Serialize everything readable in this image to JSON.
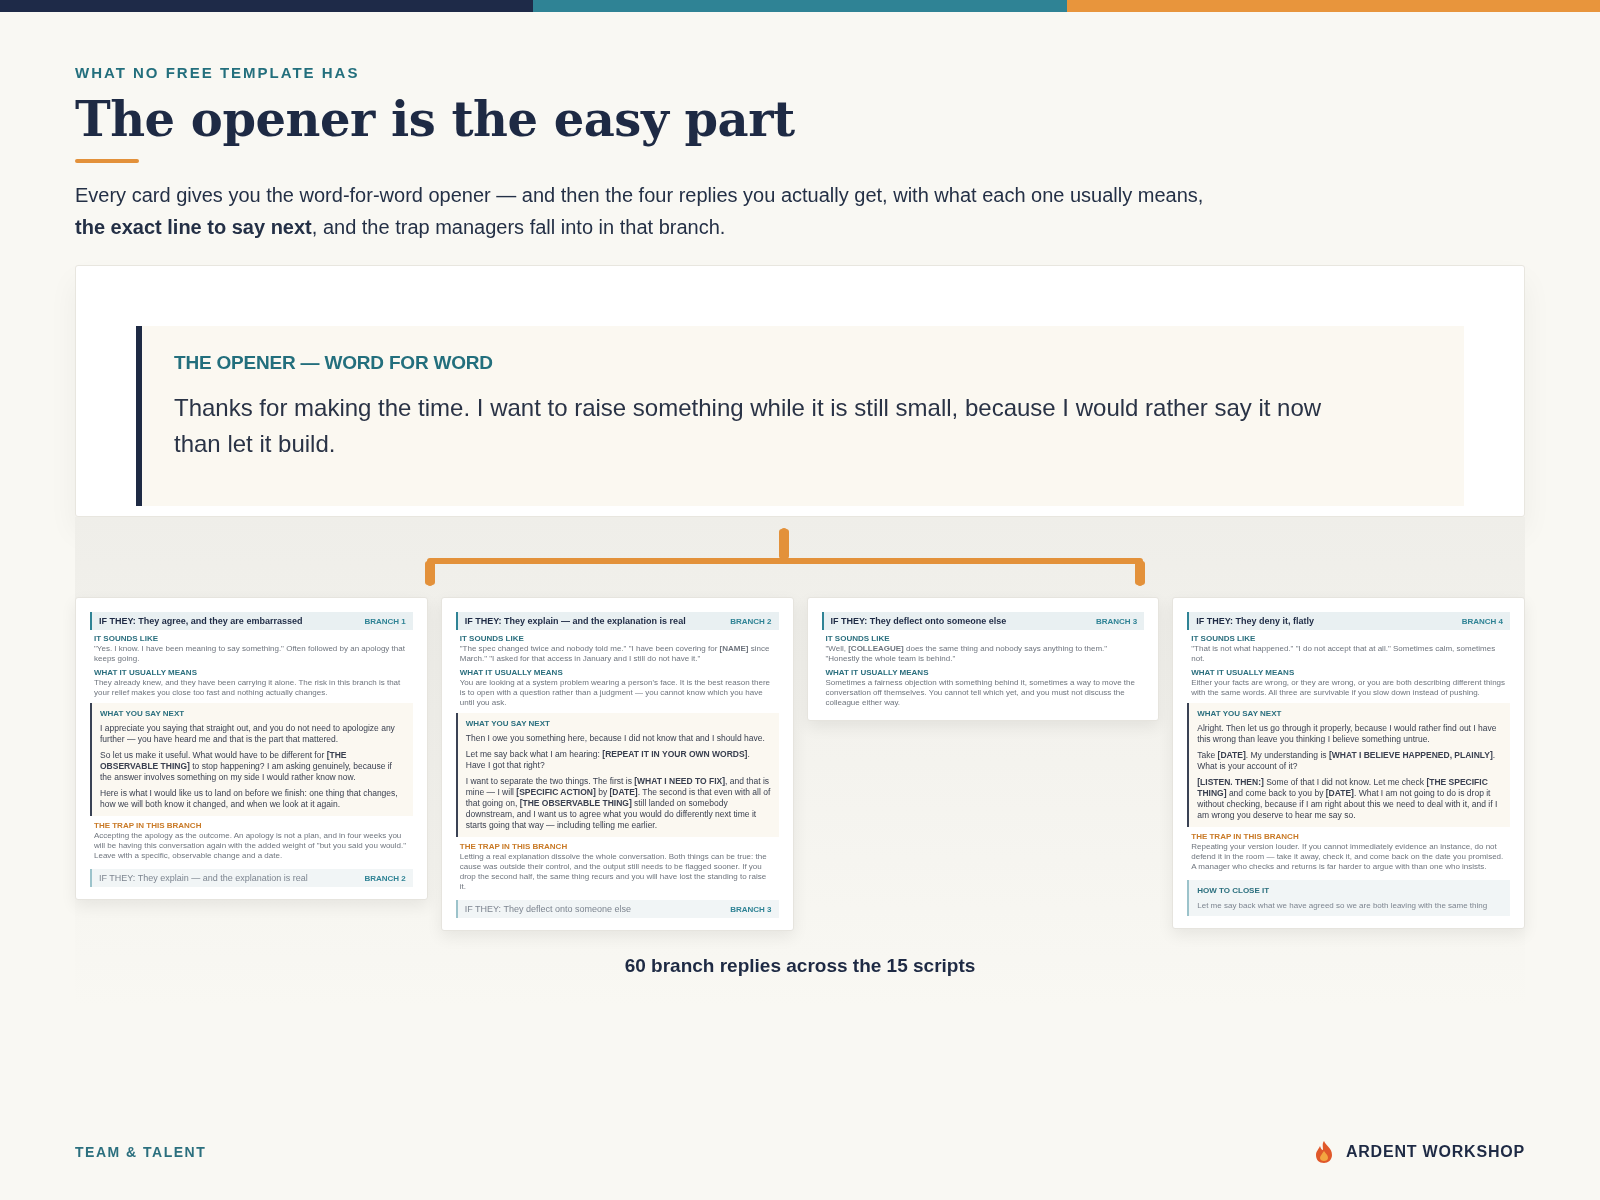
{
  "eyebrow": "WHAT NO FREE TEMPLATE HAS",
  "title": "The opener is the easy part",
  "intro": "Every card gives you the word-for-word opener — and then the four replies you actually get, with what each one usually means, **the exact line to say next**, and the trap managers fall into in that branch.",
  "opener": {
    "label": "THE OPENER — WORD FOR WORD",
    "text": "Thanks for making the time. I want to raise something while it is still small, because I would rather say it now than let it build."
  },
  "cards": [
    {
      "heading": "IF THEY: They agree, and they are embarrassed",
      "branch": "BRANCH 1",
      "sounds_like_label": "IT SOUNDS LIKE",
      "sounds_like": "\"Yes. I know. I have been meaning to say something.\" Often followed by an apology that keeps going.",
      "means_label": "WHAT IT USUALLY MEANS",
      "means": "They already knew, and they have been carrying it alone. The risk in this branch is that your relief makes you close too fast and nothing actually changes.",
      "say_next_label": "WHAT YOU SAY NEXT",
      "say_next": [
        "I appreciate you saying that straight out, and you do not need to apologize any further — you have heard me and that is the part that mattered.",
        "So let us make it useful. What would have to be different for **[THE OBSERVABLE THING]** to stop happening? I am asking genuinely, because if the answer involves something on my side I would rather know now.",
        "Here is what I would like us to land on before we finish: one thing that changes, how we will both know it changed, and when we look at it again."
      ],
      "trap_label": "THE TRAP IN THIS BRANCH",
      "trap": "Accepting the apology as the outcome. An apology is not a plan, and in four weeks you will be having this conversation again with the added weight of \"but you said you would.\" Leave with a specific, observable change and a date.",
      "next": {
        "kind": "branch",
        "heading": "IF THEY: They explain — and the explanation is real",
        "branch": "BRANCH 2"
      }
    },
    {
      "heading": "IF THEY: They explain — and the explanation is real",
      "branch": "BRANCH 2",
      "sounds_like_label": "IT SOUNDS LIKE",
      "sounds_like": "\"The spec changed twice and nobody told me.\" \"I have been covering for **[NAME]** since March.\" \"I asked for that access in January and I still do not have it.\"",
      "means_label": "WHAT IT USUALLY MEANS",
      "means": "You are looking at a system problem wearing a person's face. It is the best reason there is to open with a question rather than a judgment — you cannot know which you have until you ask.",
      "say_next_label": "WHAT YOU SAY NEXT",
      "say_next": [
        "Then I owe you something here, because I did not know that and I should have.",
        "Let me say back what I am hearing: **[REPEAT IT IN YOUR OWN WORDS]**. Have I got that right?",
        "I want to separate the two things. The first is **[WHAT I NEED TO FIX]**, and that is mine — I will **[SPECIFIC ACTION]** by **[DATE]**. The second is that even with all of that going on, **[THE OBSERVABLE THING]** still landed on somebody downstream, and I want us to agree what you would do differently next time it starts going that way — including telling me earlier."
      ],
      "trap_label": "THE TRAP IN THIS BRANCH",
      "trap": "Letting a real explanation dissolve the whole conversation. Both things can be true: the cause was outside their control, and the output still needs to be flagged sooner. If you drop the second half, the same thing recurs and you will have lost the standing to raise it.",
      "next": {
        "kind": "branch",
        "heading": "IF THEY: They deflect onto someone else",
        "branch": "BRANCH 3"
      }
    },
    {
      "heading": "IF THEY: They deflect onto someone else",
      "branch": "BRANCH 3",
      "sounds_like_label": "IT SOUNDS LIKE",
      "sounds_like": "\"Well, **[COLLEAGUE]** does the same thing and nobody says anything to them.\" \"Honestly the whole team is behind.\"",
      "means_label": "WHAT IT USUALLY MEANS",
      "means": "Sometimes a fairness objection with something behind it, sometimes a way to move the conversation off themselves. You cannot tell which yet, and you must not discuss the colleague either way."
    },
    {
      "heading": "IF THEY: They deny it, flatly",
      "branch": "BRANCH 4",
      "sounds_like_label": "IT SOUNDS LIKE",
      "sounds_like": "\"That is not what happened.\" \"I do not accept that at all.\" Sometimes calm, sometimes not.",
      "means_label": "WHAT IT USUALLY MEANS",
      "means": "Either your facts are wrong, or they are wrong, or you are both describing different things with the same words. All three are survivable if you slow down instead of pushing.",
      "say_next_label": "WHAT YOU SAY NEXT",
      "say_next": [
        "Alright. Then let us go through it properly, because I would rather find out I have this wrong than leave you thinking I believe something untrue.",
        "Take **[DATE]**. My understanding is **[WHAT I BELIEVE HAPPENED, PLAINLY]**. What is your account of it?",
        "**[LISTEN. THEN:]** Some of that I did not know. Let me check **[THE SPECIFIC THING]** and come back to you by **[DATE]**. What I am not going to do is drop it without checking, because if I am right about this we need to deal with it, and if I am wrong you deserve to hear me say so."
      ],
      "trap_label": "THE TRAP IN THIS BRANCH",
      "trap": "Repeating your version louder. If you cannot immediately evidence an instance, do not defend it in the room — take it away, check it, and come back on the date you promised. A manager who checks and returns is far harder to argue with than one who insists.",
      "next": {
        "kind": "close",
        "label": "HOW TO CLOSE IT",
        "text": "Let me say back what we have agreed so we are both leaving with the same thing"
      }
    }
  ],
  "caption": "60 branch replies across the 15 scripts",
  "footer": {
    "left": "TEAM & TALENT",
    "brand": "ARDENT WORKSHOP"
  }
}
